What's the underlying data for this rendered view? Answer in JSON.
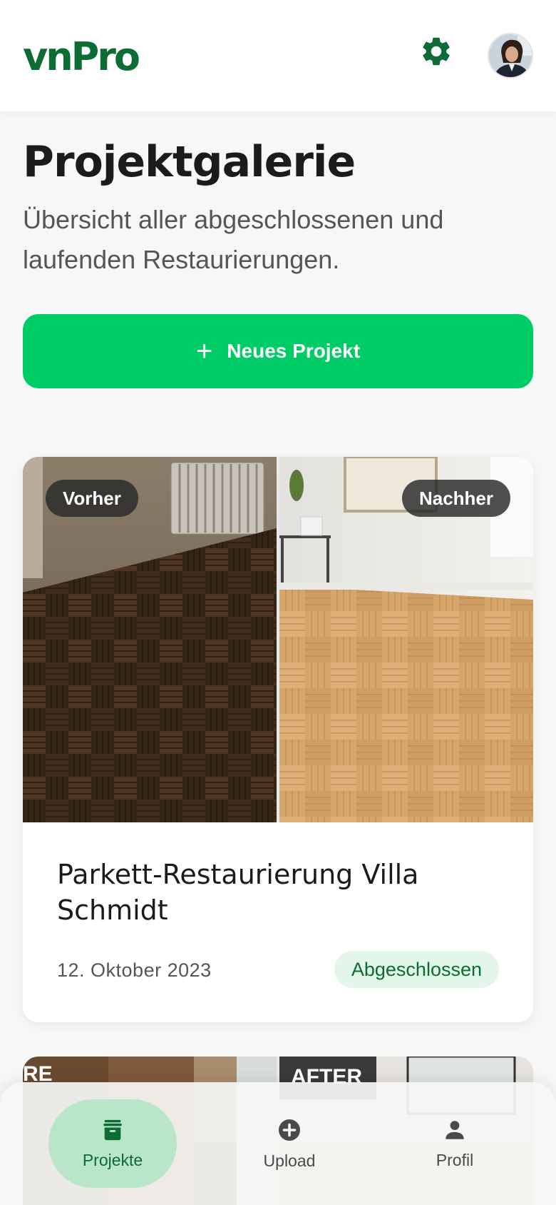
{
  "app": {
    "logo": "vnPro"
  },
  "header": {
    "settings_icon": "gear-icon",
    "avatar_icon": "user-avatar"
  },
  "page": {
    "title": "Projektgalerie",
    "subtitle": "Übersicht aller abgeschlossenen und laufenden Restaurierungen."
  },
  "cta": {
    "plus": "+",
    "label": "Neues Projekt"
  },
  "projects": [
    {
      "before_label": "Vorher",
      "after_label": "Nachher",
      "title": "Parkett-Restaurierung Villa Schmidt",
      "date": "12. Oktober 2023",
      "status": "Abgeschlossen"
    },
    {
      "before_label": "RE",
      "after_label": "AFTER"
    }
  ],
  "nav": {
    "items": [
      {
        "label": "Projekte",
        "icon": "archive-icon",
        "active": true
      },
      {
        "label": "Upload",
        "icon": "add-circle-icon",
        "active": false
      },
      {
        "label": "Profil",
        "icon": "person-icon",
        "active": false
      }
    ]
  },
  "colors": {
    "brand": "#0d6b34",
    "accent": "#00cc66",
    "status_bg": "#e3f6ea",
    "nav_active_bg": "#b9e6c8"
  }
}
